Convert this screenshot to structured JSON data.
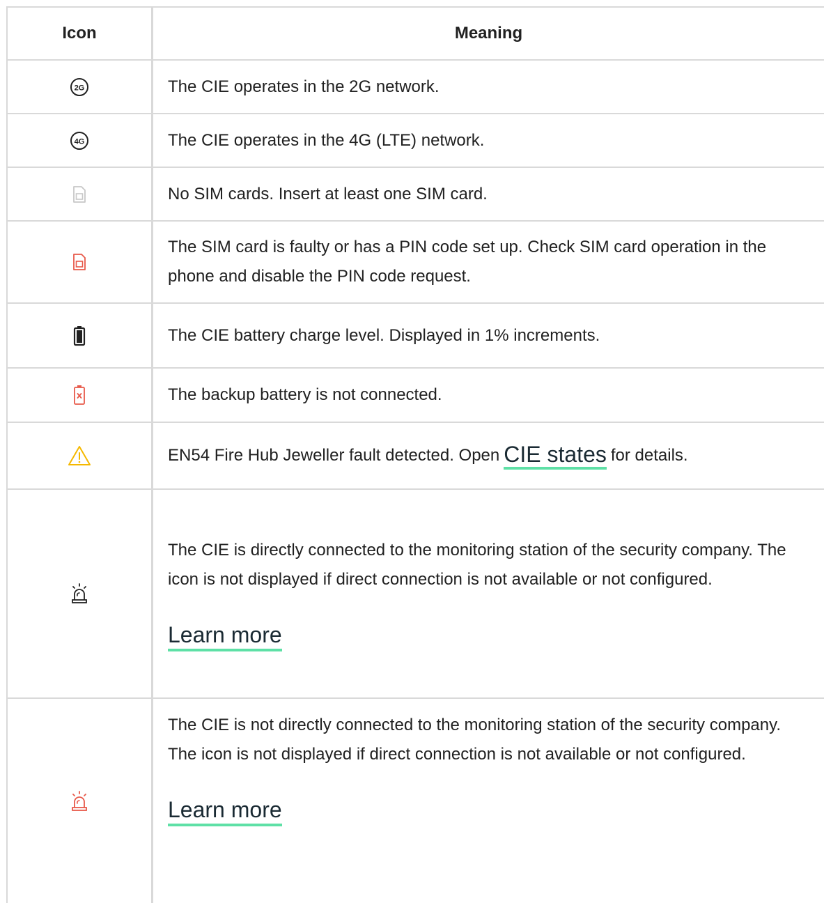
{
  "header": {
    "icon_col": "Icon",
    "meaning_col": "Meaning"
  },
  "rows": [
    {
      "icon": "2g-network-icon",
      "text": "The CIE operates in the 2G network."
    },
    {
      "icon": "4g-network-icon",
      "text": "The CIE operates in the 4G (LTE) network."
    },
    {
      "icon": "sim-card-absent-icon",
      "text": "No SIM cards. Insert at least one SIM card."
    },
    {
      "icon": "sim-card-fault-icon",
      "text": "The SIM card is faulty or has a PIN code set up. Check SIM card operation in the phone and disable the PIN code request."
    },
    {
      "icon": "battery-icon",
      "text": "The CIE battery charge level. Displayed in 1% increments."
    },
    {
      "icon": "battery-disconnected-icon",
      "text": "The backup battery is not connected."
    },
    {
      "icon": "warning-icon",
      "text_before": "EN54 Fire Hub Jeweller fault detected. Open",
      "link": "CIE states",
      "text_after": "for details."
    },
    {
      "icon": "siren-icon",
      "text": "The CIE is directly connected to the monitoring station of the security company. The icon is not displayed if direct connection is not available or not configured.",
      "link": "Learn more"
    },
    {
      "icon": "siren-red-icon",
      "text": "The CIE is not directly connected to the monitoring station of the security company. The icon is not displayed if direct connection is not available or not configured.",
      "link": "Learn more"
    }
  ],
  "icon_labels": {
    "2g": "2G",
    "4g": "4G"
  },
  "colors": {
    "border": "#d9d9d9",
    "text": "#212121",
    "link_underline": "#5ee0a6",
    "fault_red": "#e8594a",
    "warning_yellow": "#f5b800",
    "gray_icon": "#c8c8c8"
  }
}
